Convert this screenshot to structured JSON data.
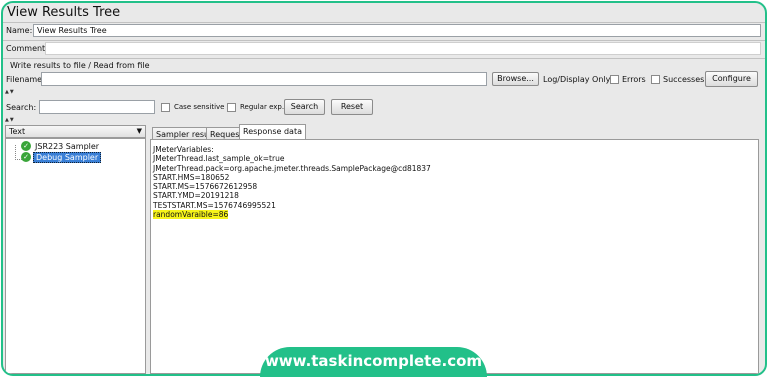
{
  "window": {
    "title": "View Results Tree"
  },
  "name_field": {
    "label": "Name:",
    "value": "View Results Tree"
  },
  "comments_field": {
    "label": "Comments:",
    "value": ""
  },
  "file_section": {
    "heading": "Write results to file / Read from file",
    "filename_label": "Filename",
    "filename_value": "",
    "browse_label": "Browse...",
    "log_display_label": "Log/Display Only:",
    "errors_label": "Errors",
    "successes_label": "Successes",
    "configure_label": "Configure"
  },
  "search": {
    "label": "Search:",
    "value": "",
    "case_sensitive_label": "Case sensitive",
    "regexp_label": "Regular exp.",
    "search_button": "Search",
    "reset_button": "Reset"
  },
  "renderer": {
    "selected": "Text"
  },
  "tree": {
    "items": [
      {
        "label": "JSR223 Sampler",
        "status": "success",
        "selected": false
      },
      {
        "label": "Debug Sampler",
        "status": "success",
        "selected": true
      }
    ]
  },
  "tabs": [
    {
      "label": "Sampler result",
      "active": false
    },
    {
      "label": "Request",
      "active": false
    },
    {
      "label": "Response data",
      "active": true
    }
  ],
  "response": {
    "lines": [
      "JMeterVariables:",
      "JMeterThread.last_sample_ok=true",
      "JMeterThread.pack=org.apache.jmeter.threads.SamplePackage@cd81837",
      "START.HMS=180652",
      "START.MS=1576672612958",
      "START.YMD=20191218",
      "TESTSTART.MS=1576746995521"
    ],
    "highlighted_line": "randomVaraible=86"
  },
  "watermark": "www.taskincomplete.com",
  "colors": {
    "accent": "#22c089",
    "highlight": "#f6f41a",
    "selection": "#3a7fd6",
    "success": "#3aa53a"
  }
}
